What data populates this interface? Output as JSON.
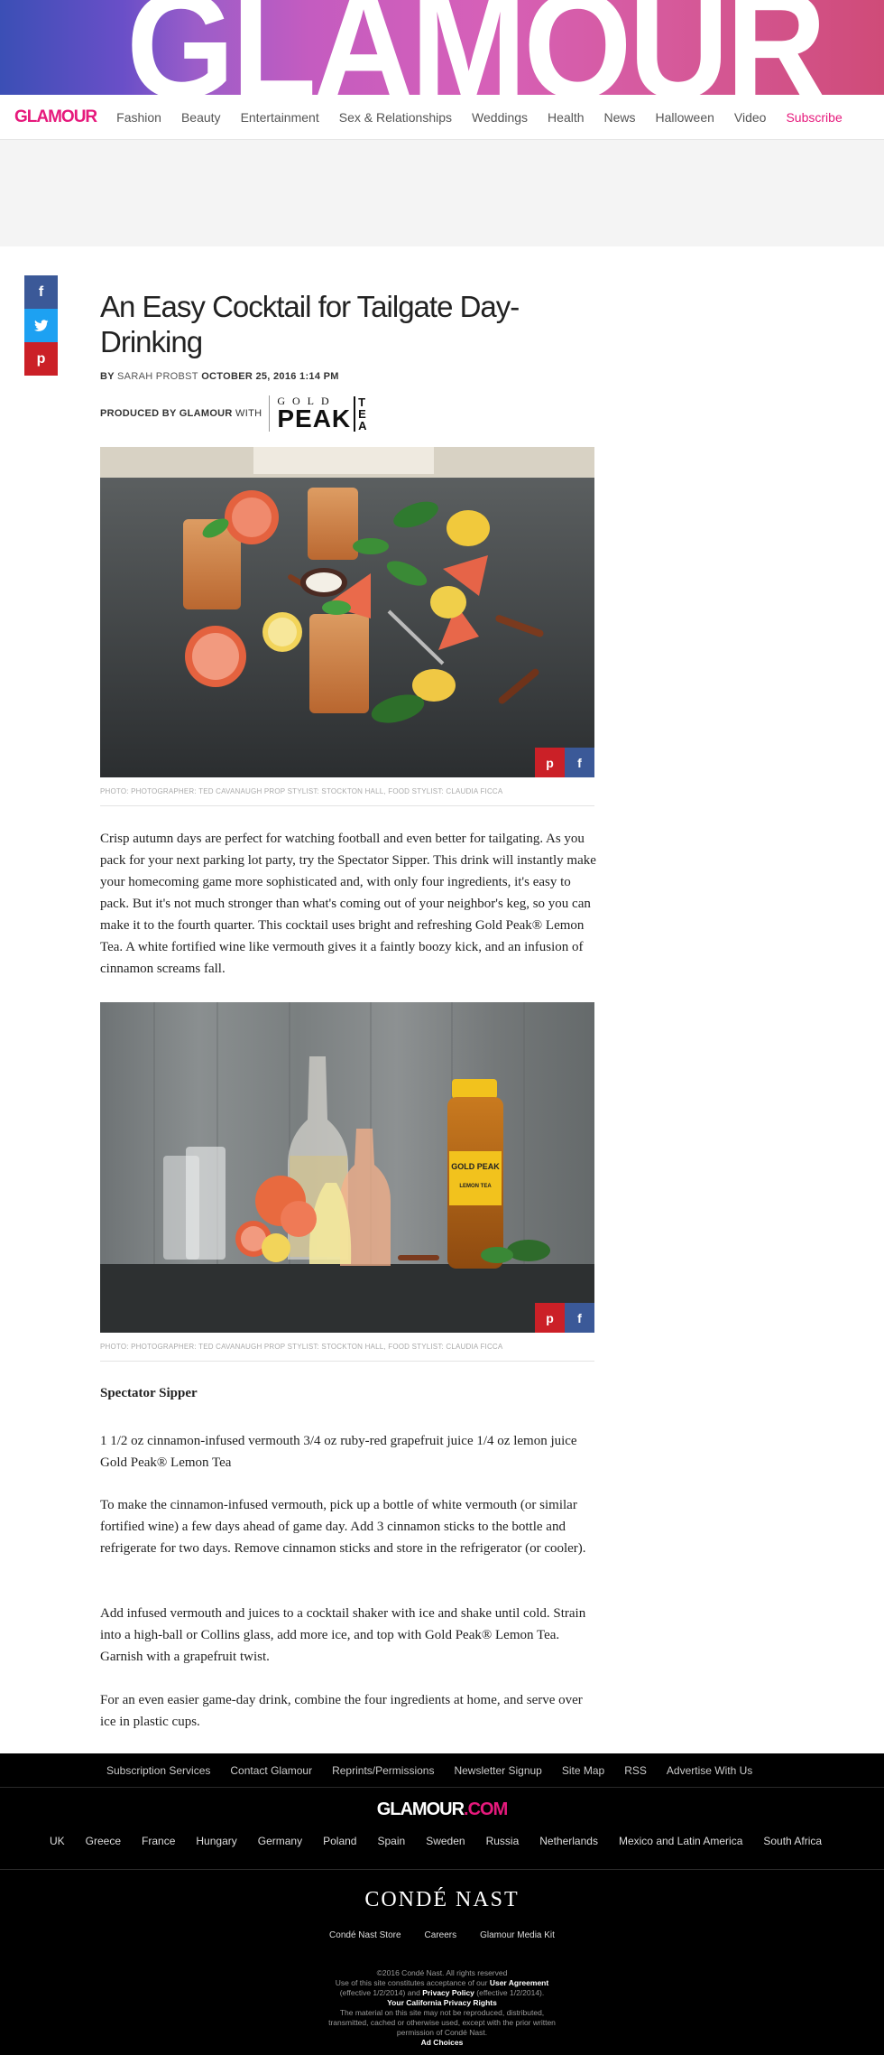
{
  "banner": {
    "word": "GLAMOUR"
  },
  "nav": {
    "logo": "GLAMOUR",
    "items": [
      "Fashion",
      "Beauty",
      "Entertainment",
      "Sex & Relationships",
      "Weddings",
      "Health",
      "News",
      "Halloween",
      "Video"
    ],
    "subscribe": "Subscribe"
  },
  "share": {
    "facebook": "f",
    "twitter": "t",
    "pinterest": "p"
  },
  "article": {
    "title": "An Easy Cocktail for Tailgate Day-Drinking",
    "by": "BY",
    "author": "SARAH PROBST",
    "date": "OCTOBER 25, 2016 1:14 PM",
    "produced": "PRODUCED BY GLAMOUR",
    "with": "WITH",
    "sponsor": {
      "gold": "GOLD",
      "peak": "PEAK",
      "t": "T",
      "e": "E",
      "a": "A"
    },
    "photo_credit_1": "PHOTO: PHOTOGRAPHER: TED CAVANAUGH PROP STYLIST: STOCKTON HALL, FOOD STYLIST: CLAUDIA FICCA",
    "photo_credit_2": "PHOTO: PHOTOGRAPHER: TED CAVANAUGH PROP STYLIST: STOCKTON HALL, FOOD STYLIST: CLAUDIA FICCA",
    "intro": "Crisp autumn days are perfect for watching football and even better for tailgating. As you pack for your next parking lot party, try the Spectator Sipper. This drink will instantly make your homecoming game more sophisticated and, with only four ingredients, it's easy to pack. But it's not much stronger than what's coming out of your neighbor's keg, so you can make it to the fourth quarter. This cocktail uses bright and refreshing Gold Peak® Lemon Tea. A white fortified wine like vermouth gives it a faintly boozy kick, and an infusion of cinnamon screams fall.",
    "recipe_title": "Spectator Sipper",
    "ingredients": "1 1/2 oz cinnamon-infused vermouth 3/4 oz ruby-red grapefruit juice 1/4 oz lemon juice Gold Peak® Lemon Tea",
    "step1": "To make the cinnamon-infused vermouth, pick up a bottle of white vermouth (or similar fortified wine) a few days ahead of game day. Add 3 cinnamon sticks to the bottle and refrigerate for two days. Remove cinnamon sticks and store in the refrigerator (or cooler).",
    "step2": "Add infused vermouth and juices to a cocktail shaker with ice and shake until cold. Strain into a high-ball or Collins glass, add more ice, and top with Gold Peak® Lemon Tea. Garnish with a grapefruit twist.",
    "step3": "For an even easier game-day drink, combine the four ingredients at home, and serve over ice in plastic cups.",
    "bottle_label": {
      "brand": "GOLD PEAK",
      "flavor": "LEMON TEA"
    }
  },
  "footer": {
    "links": [
      "Subscription Services",
      "Contact Glamour",
      "Reprints/Permissions",
      "Newsletter Signup",
      "Site Map",
      "RSS",
      "Advertise With Us"
    ],
    "logo_glamour": "GLAMOUR",
    "logo_com": ".COM",
    "countries": [
      "UK",
      "Greece",
      "France",
      "Hungary",
      "Germany",
      "Poland",
      "Spain",
      "Sweden",
      "Russia",
      "Netherlands",
      "Mexico and Latin America",
      "South Africa"
    ],
    "conde": "CONDÉ NAST",
    "conde_links": [
      "Condé Nast Store",
      "Careers",
      "Glamour Media Kit"
    ],
    "legal": {
      "l1": "©2016 Condé Nast. All rights reserved",
      "l2a": "Use of this site constitutes acceptance of our",
      "user_agreement": "User Agreement",
      "l3a": "(effective 1/2/2014) and",
      "privacy": "Privacy Policy",
      "l3b": "(effective 1/2/2014).",
      "ca_privacy": "Your California Privacy Rights",
      "l5": "The material on this site may not be reproduced, distributed,",
      "l6": "transmitted, cached or otherwise used, except with the prior written",
      "l7": "permission of Condé Nast.",
      "ad_choices": "Ad Choices"
    }
  },
  "colors": {
    "brand_pink": "#e6197c",
    "facebook": "#3b5998",
    "twitter": "#1da1f2",
    "pinterest": "#cb2027"
  }
}
